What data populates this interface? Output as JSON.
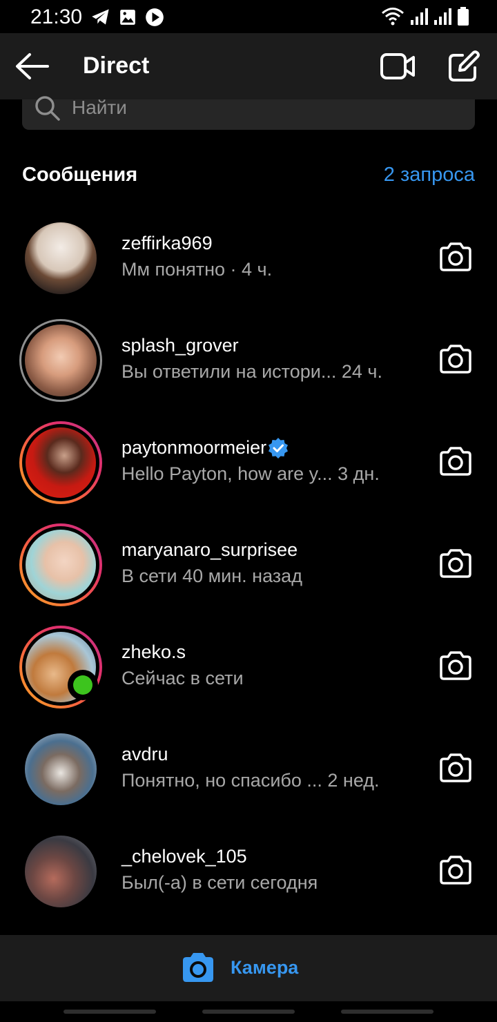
{
  "status_bar": {
    "time": "21:30",
    "left_icons": [
      "telegram-icon",
      "image-icon",
      "play-icon"
    ],
    "right_icons": [
      "wifi-icon",
      "signal-icon",
      "signal-icon",
      "battery-icon"
    ]
  },
  "header": {
    "back_icon": "arrow-left-icon",
    "title": "Direct",
    "video_icon": "video-camera-icon",
    "compose_icon": "compose-icon"
  },
  "search": {
    "placeholder": "Найти",
    "icon": "search-icon"
  },
  "section": {
    "title": "Сообщения",
    "requests_link": "2 запроса"
  },
  "threads": [
    {
      "username": "zeffirka969",
      "preview": "Мм понятно · 4 ч.",
      "verified": false,
      "ring": "none",
      "online": false
    },
    {
      "username": "splash_grover",
      "preview": "Вы ответили на истори...  24 ч.",
      "verified": false,
      "ring": "gray",
      "online": false
    },
    {
      "username": "paytonmoormeier",
      "preview": "Hello Payton,  how are y...  3 дн.",
      "verified": true,
      "ring": "story",
      "online": false
    },
    {
      "username": "maryanaro_surprisee",
      "preview": "В сети 40 мин. назад",
      "verified": false,
      "ring": "story",
      "online": false
    },
    {
      "username": "zheko.s",
      "preview": "Сейчас в сети",
      "verified": false,
      "ring": "story",
      "online": true
    },
    {
      "username": "avdru",
      "preview": "Понятно, но спасибо  ...  2 нед.",
      "verified": false,
      "ring": "none",
      "online": false
    },
    {
      "username": "_chelovek_105",
      "preview": "Был(-а) в сети сегодня",
      "verified": false,
      "ring": "none",
      "online": false
    }
  ],
  "bottom_bar": {
    "camera_label": "Камера",
    "camera_icon": "camera-icon"
  },
  "colors": {
    "accent": "#3797f0",
    "background": "#000000",
    "surface": "#1c1c1c",
    "secondary_text": "#a8a8a8",
    "online": "#3dc41e"
  }
}
